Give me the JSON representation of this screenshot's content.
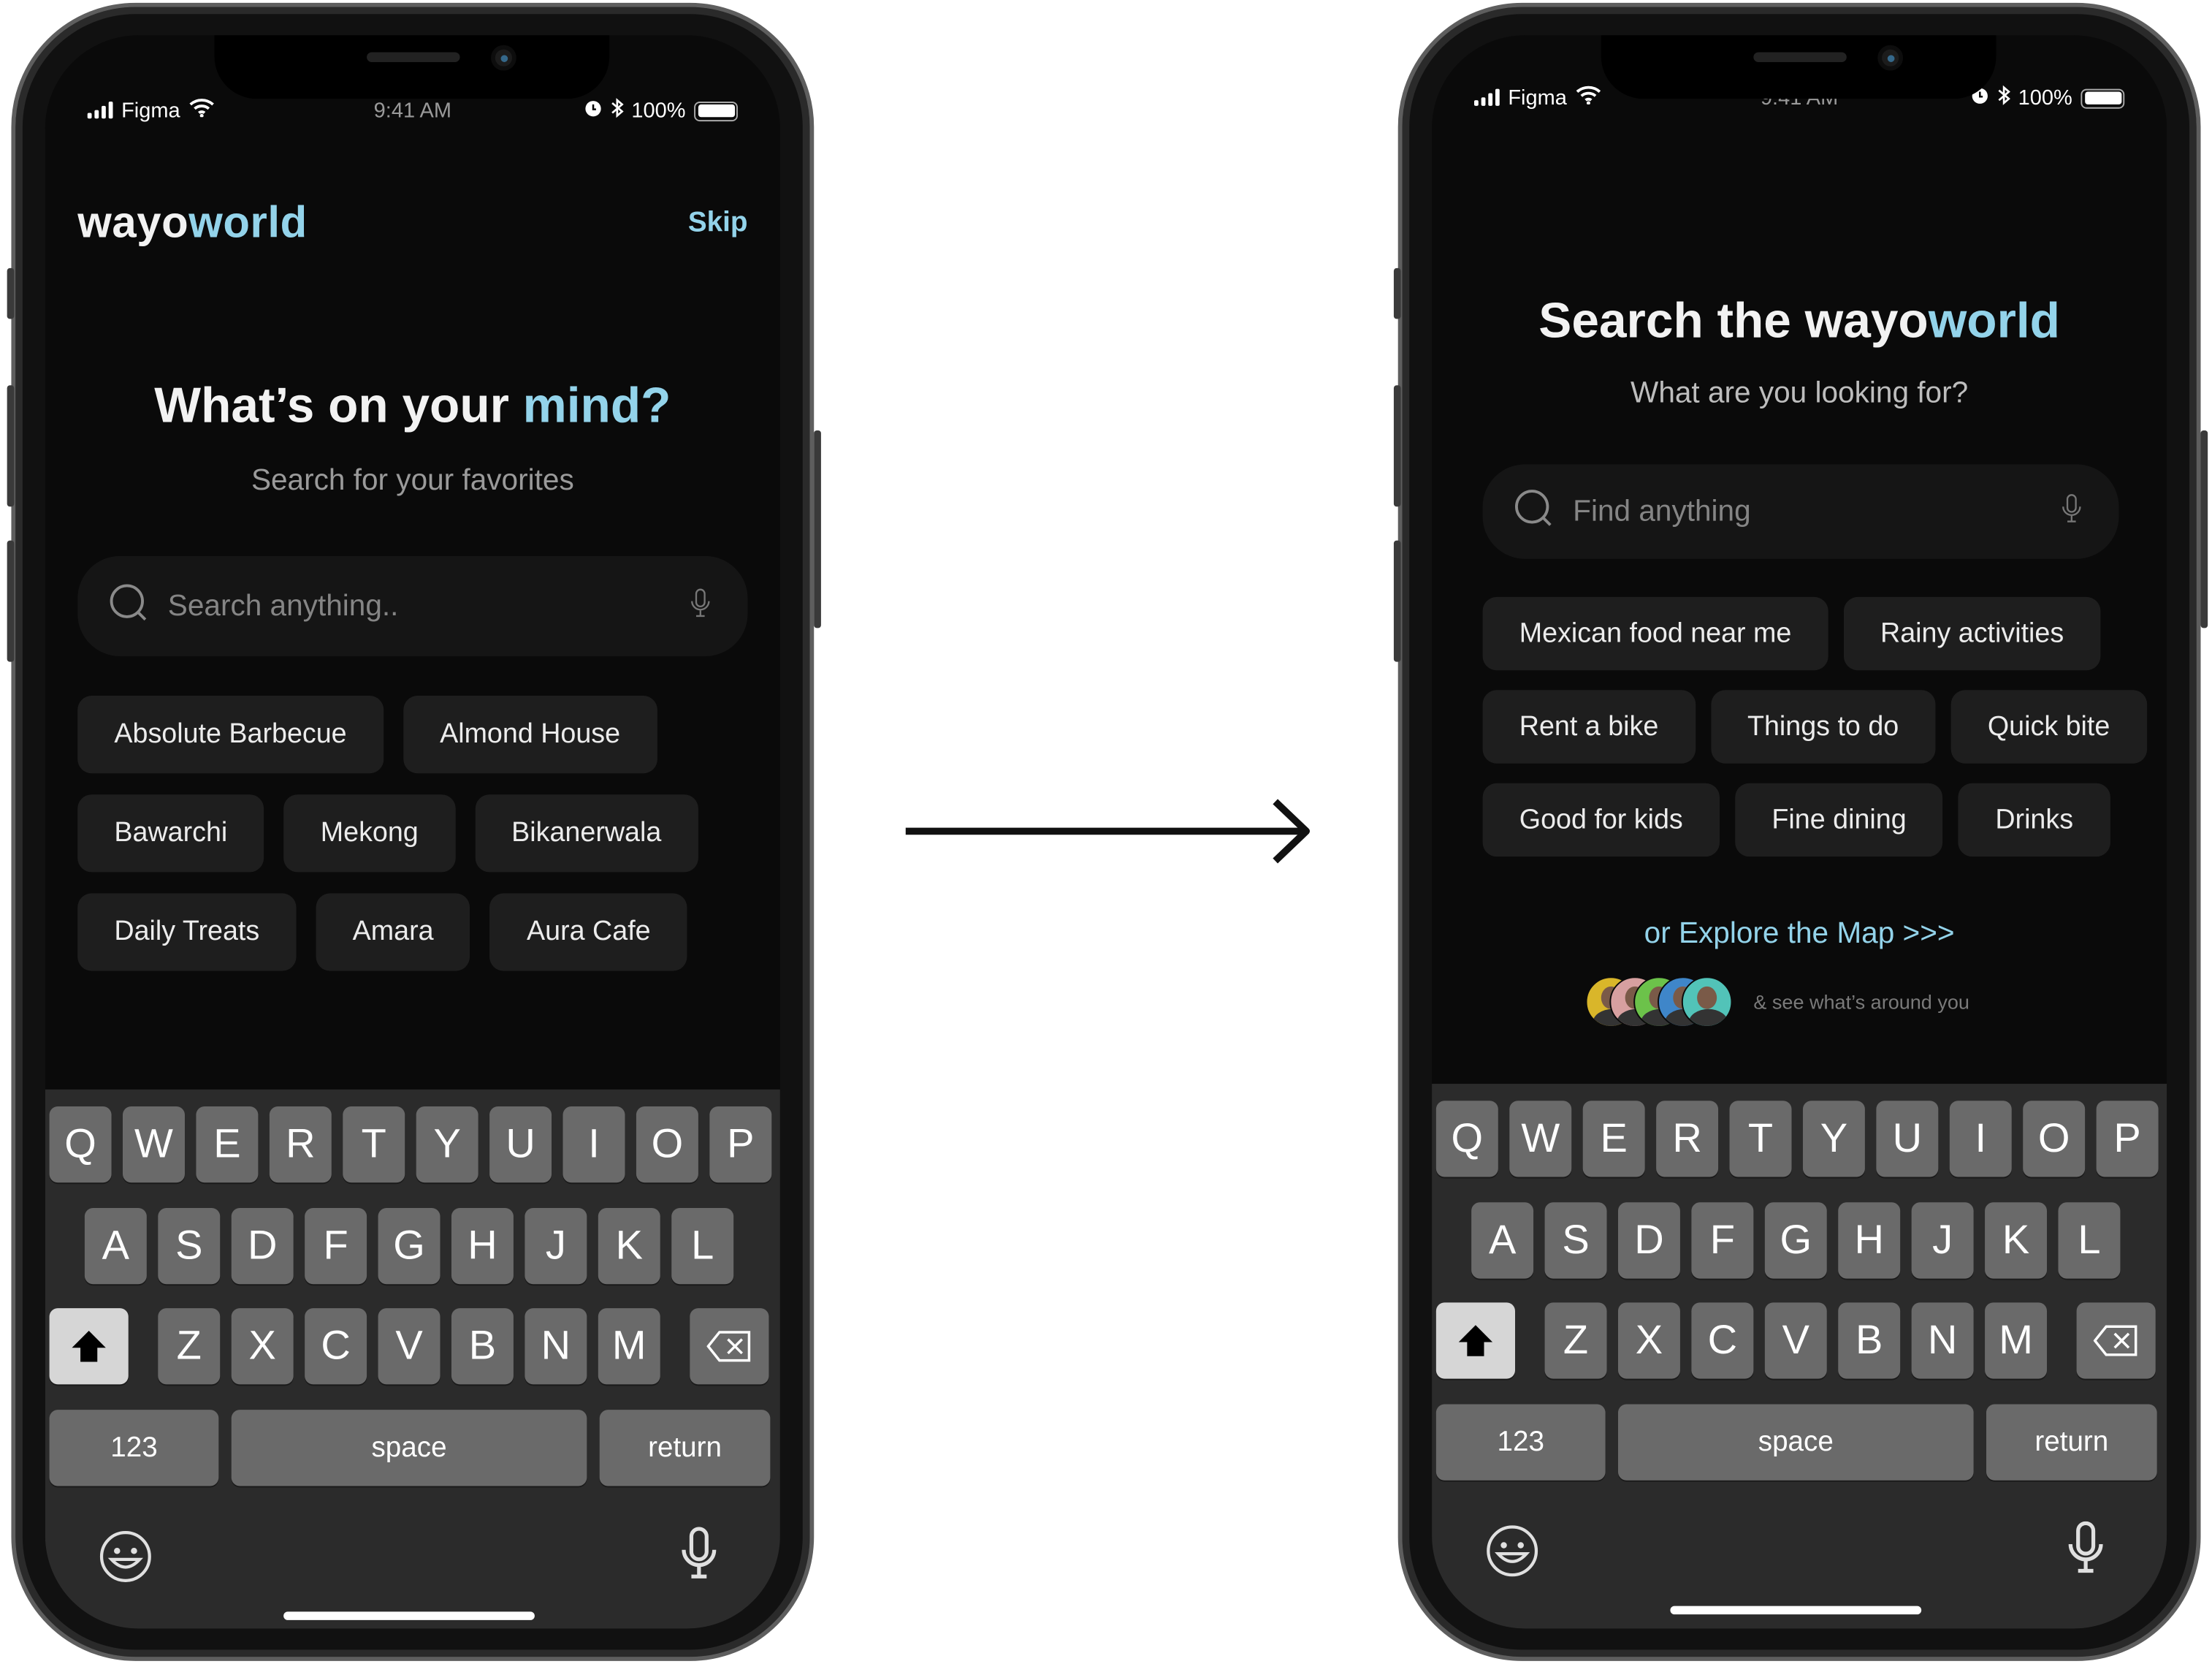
{
  "status_bar": {
    "carrier": "Figma",
    "time": "9:41 AM",
    "battery": "100%"
  },
  "screen1": {
    "logo": {
      "part1": "wayo",
      "part2": "world"
    },
    "skip_label": "Skip",
    "heading": {
      "part1": "What’s on your ",
      "part2": "mind?"
    },
    "subtitle": "Search for your favorites",
    "search_placeholder": "Search anything..",
    "chips": [
      "Absolute Barbecue",
      "Almond House",
      "Bawarchi",
      "Mekong",
      "Bikanerwala",
      "Daily Treats",
      "Amara",
      "Aura Cafe"
    ]
  },
  "screen2": {
    "heading": {
      "part1": "Search the wayo",
      "part2": "world"
    },
    "subtitle": "What are you looking for?",
    "search_placeholder": "Find anything",
    "chips": [
      "Mexican food near me",
      "Rainy activities",
      "Rent a bike",
      "Things to do",
      "Quick bite",
      "Good for kids",
      "Fine dining",
      "Drinks"
    ],
    "explore_link": "or Explore the Map >>>",
    "nearby_text": "& see what’s around you",
    "avatar_colors": [
      "#d9b62a",
      "#d7a0a0",
      "#6cc24a",
      "#3f86c9",
      "#52c3b8"
    ]
  },
  "keyboard": {
    "row1": [
      "Q",
      "W",
      "E",
      "R",
      "T",
      "Y",
      "U",
      "I",
      "O",
      "P"
    ],
    "row2": [
      "A",
      "S",
      "D",
      "F",
      "G",
      "H",
      "J",
      "K",
      "L"
    ],
    "row3": [
      "Z",
      "X",
      "C",
      "V",
      "B",
      "N",
      "M"
    ],
    "numbers_label": "123",
    "space_label": "space",
    "return_label": "return"
  },
  "colors": {
    "accent": "#93d3ea",
    "screen_bg": "#0a0a0a",
    "chip_bg": "#1e1e1e",
    "key_bg": "#6a6a6a",
    "keyboard_bg": "#2b2b2b"
  },
  "icons": [
    "signal-icon",
    "wifi-icon",
    "alarm-icon",
    "bluetooth-icon",
    "battery-icon",
    "search-icon",
    "microphone-icon",
    "shift-icon",
    "delete-icon",
    "emoji-icon",
    "arrow-right-icon"
  ]
}
